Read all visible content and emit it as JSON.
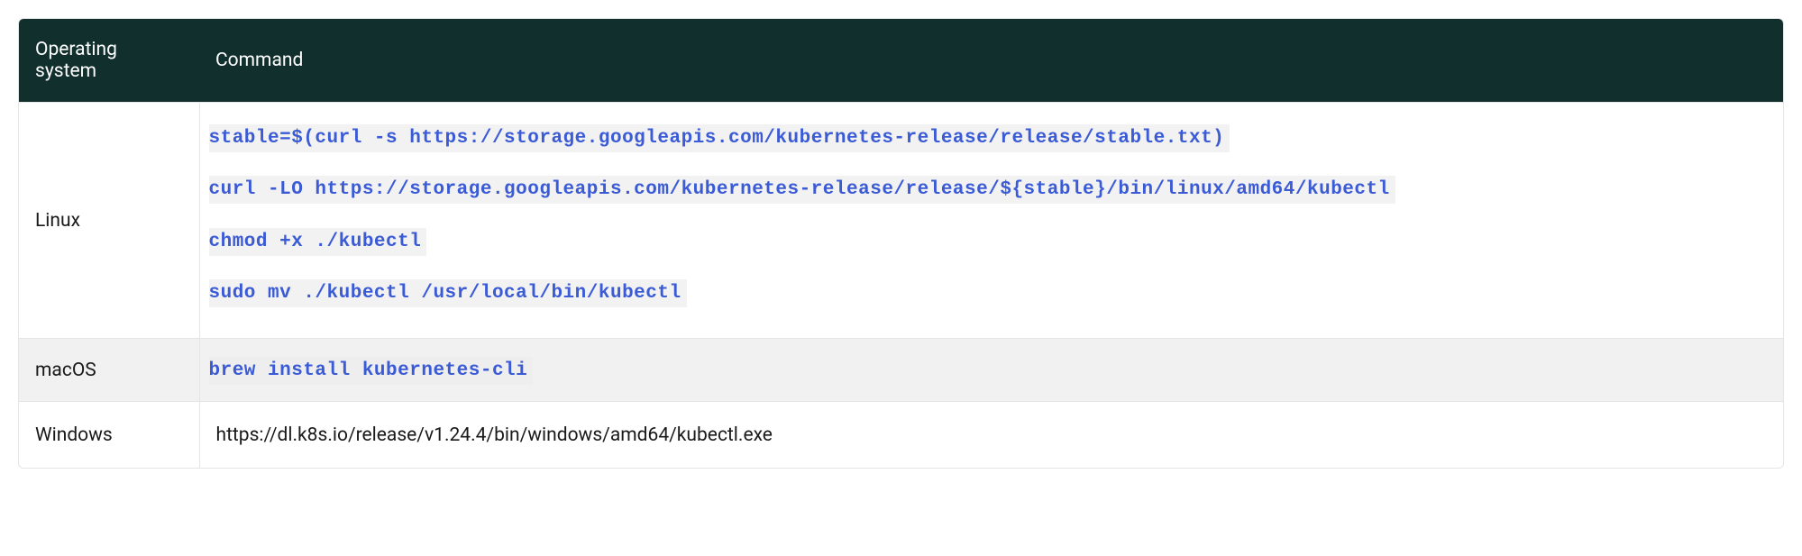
{
  "table": {
    "headers": {
      "os": "Operating system",
      "command": "Command"
    },
    "rows": {
      "linux": {
        "os": "Linux",
        "cmds": [
          "stable=$(curl -s https://storage.googleapis.com/kubernetes-release/release/stable.txt)",
          "curl -LO https://storage.googleapis.com/kubernetes-release/release/${stable}/bin/linux/amd64/kubectl",
          "chmod +x ./kubectl",
          "sudo mv ./kubectl /usr/local/bin/kubectl"
        ]
      },
      "macos": {
        "os": "macOS",
        "cmds": [
          "brew install kubernetes-cli"
        ]
      },
      "windows": {
        "os": "Windows",
        "link": "https://dl.k8s.io/release/v1.24.4/bin/windows/amd64/kubectl.exe"
      }
    }
  }
}
